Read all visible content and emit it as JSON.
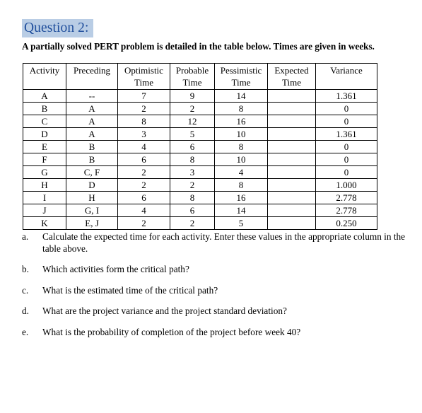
{
  "heading": {
    "label": "Question 2:",
    "highlight_color": "#b9cde5",
    "text_color": "#1f4e9c"
  },
  "subtitle": "A partially solved PERT problem is detailed in the table below. Times are given in weeks.",
  "table": {
    "columns": [
      {
        "line1": "Activity",
        "line2": ""
      },
      {
        "line1": "Preceding",
        "line2": ""
      },
      {
        "line1": "Optimistic",
        "line2": "Time"
      },
      {
        "line1": "Probable",
        "line2": "Time"
      },
      {
        "line1": "Pessimistic",
        "line2": "Time"
      },
      {
        "line1": "Expected",
        "line2": "Time"
      },
      {
        "line1": "Variance",
        "line2": ""
      }
    ],
    "rows": [
      {
        "activity": "A",
        "preceding": "--",
        "optimistic": "7",
        "probable": "9",
        "pessimistic": "14",
        "expected": "",
        "variance": "1.361"
      },
      {
        "activity": "B",
        "preceding": "A",
        "optimistic": "2",
        "probable": "2",
        "pessimistic": "8",
        "expected": "",
        "variance": "0"
      },
      {
        "activity": "C",
        "preceding": "A",
        "optimistic": "8",
        "probable": "12",
        "pessimistic": "16",
        "expected": "",
        "variance": "0"
      },
      {
        "activity": "D",
        "preceding": "A",
        "optimistic": "3",
        "probable": "5",
        "pessimistic": "10",
        "expected": "",
        "variance": "1.361"
      },
      {
        "activity": "E",
        "preceding": "B",
        "optimistic": "4",
        "probable": "6",
        "pessimistic": "8",
        "expected": "",
        "variance": "0"
      },
      {
        "activity": "F",
        "preceding": "B",
        "optimistic": "6",
        "probable": "8",
        "pessimistic": "10",
        "expected": "",
        "variance": "0"
      },
      {
        "activity": "G",
        "preceding": "C, F",
        "optimistic": "2",
        "probable": "3",
        "pessimistic": "4",
        "expected": "",
        "variance": "0"
      },
      {
        "activity": "H",
        "preceding": "D",
        "optimistic": "2",
        "probable": "2",
        "pessimistic": "8",
        "expected": "",
        "variance": "1.000"
      },
      {
        "activity": "I",
        "preceding": "H",
        "optimistic": "6",
        "probable": "8",
        "pessimistic": "16",
        "expected": "",
        "variance": "2.778"
      },
      {
        "activity": "J",
        "preceding": "G, I",
        "optimistic": "4",
        "probable": "6",
        "pessimistic": "14",
        "expected": "",
        "variance": "2.778"
      },
      {
        "activity": "K",
        "preceding": "E, J",
        "optimistic": "2",
        "probable": "2",
        "pessimistic": "5",
        "expected": "",
        "variance": "0.250"
      }
    ]
  },
  "questions": [
    {
      "marker": "a.",
      "text": "Calculate the expected time for each activity. Enter these values in the appropriate column in the table above."
    },
    {
      "marker": "b.",
      "text": "Which activities form the critical path?"
    },
    {
      "marker": "c.",
      "text": "What is the estimated time of the critical path?"
    },
    {
      "marker": "d.",
      "text": "What are the project variance and the project standard deviation?"
    },
    {
      "marker": "e.",
      "text": "What is the probability of completion of the project before week 40?"
    }
  ]
}
